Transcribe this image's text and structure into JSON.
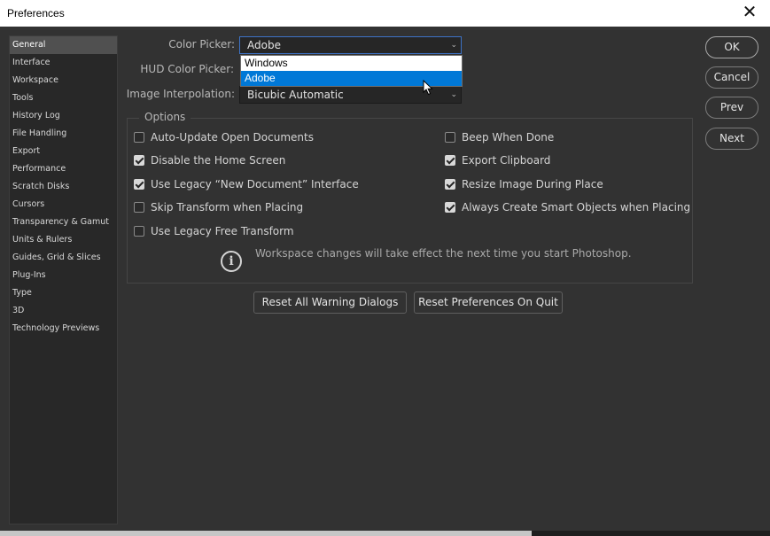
{
  "window": {
    "title": "Preferences",
    "close_glyph": "✕"
  },
  "sidebar": {
    "items": [
      {
        "label": "General",
        "active": true
      },
      {
        "label": "Interface"
      },
      {
        "label": "Workspace"
      },
      {
        "label": "Tools"
      },
      {
        "label": "History Log"
      },
      {
        "label": "File Handling"
      },
      {
        "label": "Export"
      },
      {
        "label": "Performance"
      },
      {
        "label": "Scratch Disks"
      },
      {
        "label": "Cursors"
      },
      {
        "label": "Transparency & Gamut"
      },
      {
        "label": "Units & Rulers"
      },
      {
        "label": "Guides, Grid & Slices"
      },
      {
        "label": "Plug-Ins"
      },
      {
        "label": "Type"
      },
      {
        "label": "3D"
      },
      {
        "label": "Technology Previews"
      }
    ]
  },
  "color_picker": {
    "label": "Color Picker:",
    "value": "Adobe",
    "options": [
      "Windows",
      "Adobe"
    ],
    "highlighted": "Adobe"
  },
  "hud_color_picker": {
    "label": "HUD Color Picker:"
  },
  "image_interpolation": {
    "label": "Image Interpolation:",
    "value": "Bicubic Automatic"
  },
  "options": {
    "title": "Options",
    "left": [
      {
        "label": "Auto-Update Open Documents",
        "checked": false
      },
      {
        "label": "Disable the Home Screen",
        "checked": true
      },
      {
        "label": "Use Legacy “New Document” Interface",
        "checked": true
      },
      {
        "label": "Skip Transform when Placing",
        "checked": false
      },
      {
        "label": "Use Legacy Free Transform",
        "checked": false
      }
    ],
    "right": [
      {
        "label": "Beep When Done",
        "checked": false
      },
      {
        "label": "Export Clipboard",
        "checked": true
      },
      {
        "label": "Resize Image During Place",
        "checked": true
      },
      {
        "label": "Always Create Smart Objects when Placing",
        "checked": true
      }
    ],
    "info_text": "Workspace changes will take effect the next time you start Photoshop.",
    "info_icon": "i"
  },
  "buttons": {
    "ok": "OK",
    "cancel": "Cancel",
    "prev": "Prev",
    "next": "Next",
    "reset_warnings": "Reset All Warning Dialogs",
    "reset_prefs": "Reset Preferences On Quit"
  },
  "colors": {
    "dialog_bg": "#323232",
    "sidebar_bg": "#282828",
    "accent": "#0078d7"
  }
}
